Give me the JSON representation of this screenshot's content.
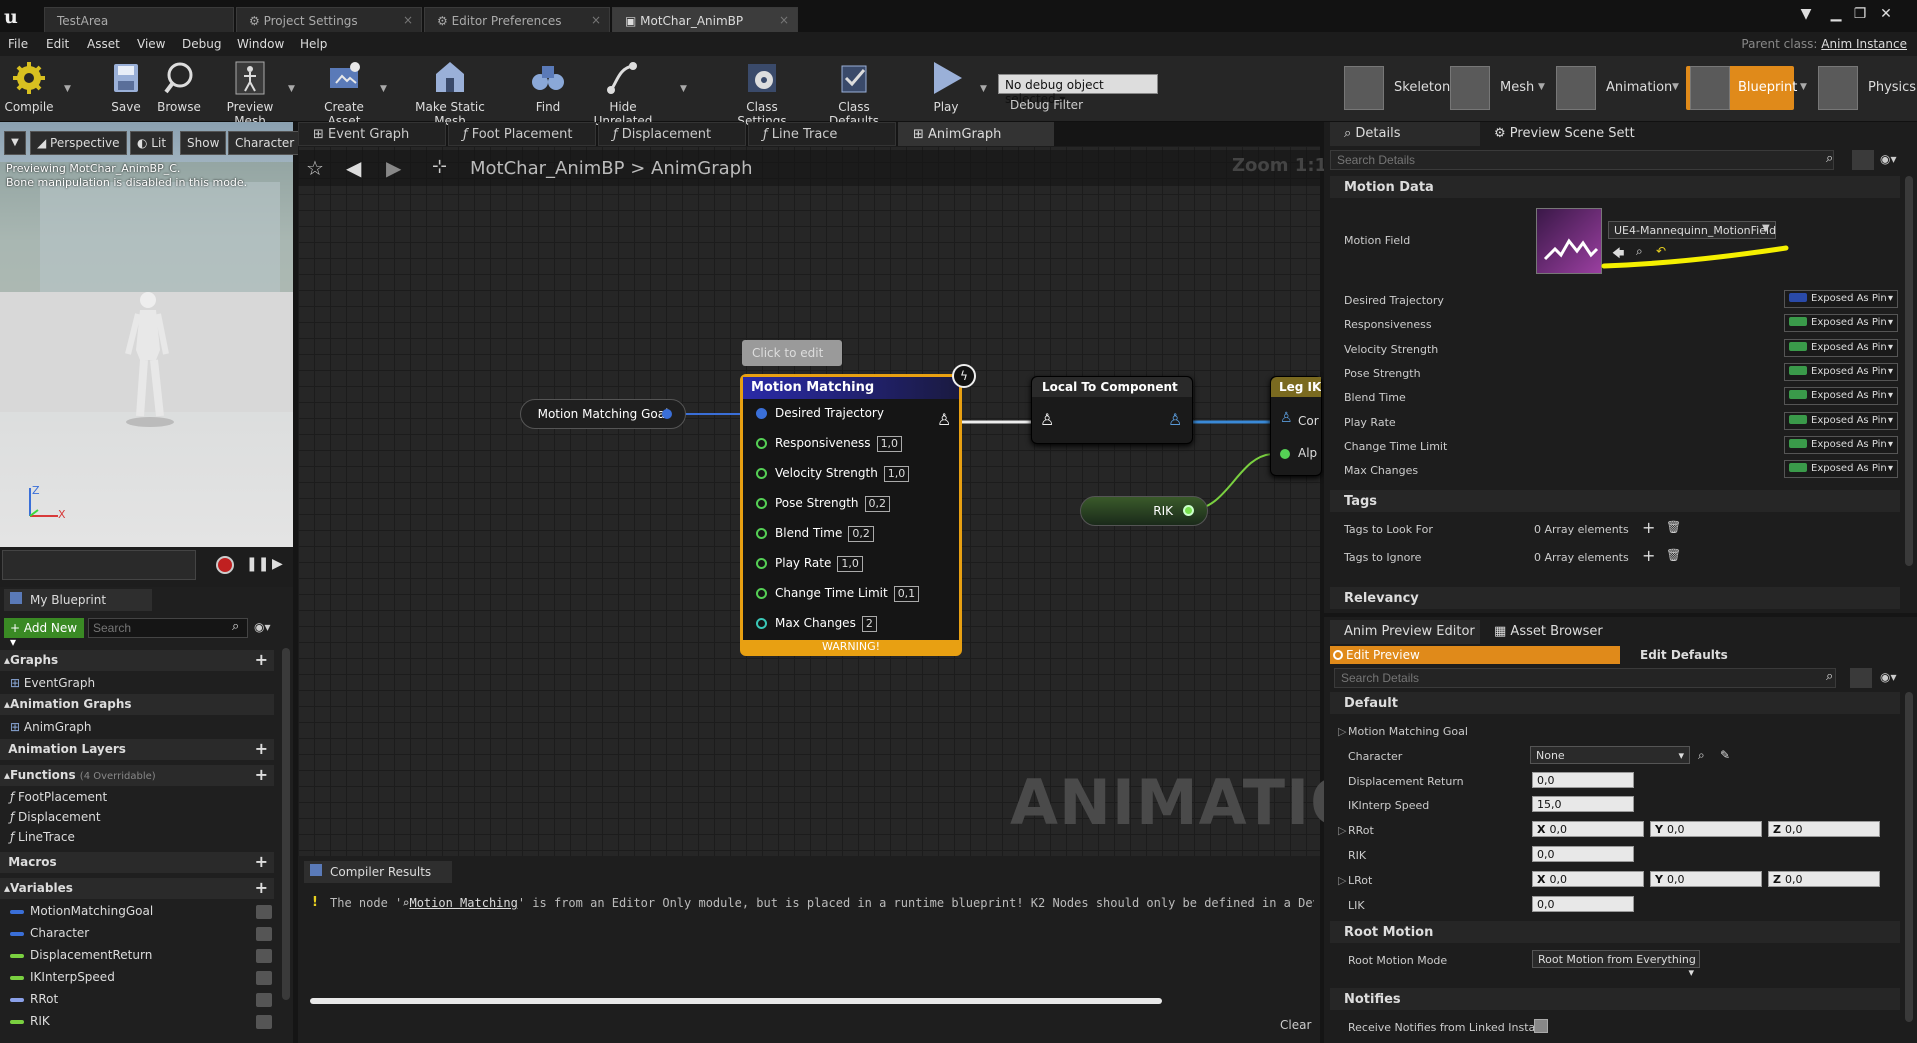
{
  "doc_tabs": [
    {
      "label": "TestArea"
    },
    {
      "label": "Project Settings"
    },
    {
      "label": "Editor Preferences"
    },
    {
      "label": "MotChar_AnimBP"
    }
  ],
  "menu": [
    "File",
    "Edit",
    "Asset",
    "View",
    "Debug",
    "Window",
    "Help"
  ],
  "parent_class": {
    "label": "Parent class:",
    "value": "Anim Instance"
  },
  "toolbar": {
    "buttons": [
      "Compile",
      "Save",
      "Browse",
      "Preview Mesh",
      "Create Asset",
      "Make Static Mesh",
      "Find",
      "Hide Unrelated",
      "Class Settings",
      "Class Defaults",
      "Play"
    ],
    "debug_object": "No debug object selected",
    "debug_filter": "Debug Filter"
  },
  "modes": [
    "Skeleton",
    "Mesh",
    "Animation",
    "Blueprint",
    "Physics"
  ],
  "viewport": {
    "buttons": [
      "Perspective",
      "Lit",
      "Show",
      "Character"
    ],
    "overlay_line1": "Previewing MotChar_AnimBP_C.",
    "overlay_line2": "Bone manipulation is disabled in this mode.",
    "axis_z": "Z",
    "axis_x": "X"
  },
  "my_blueprint": {
    "tab": "My Blueprint",
    "add_new": "+ Add New",
    "search_placeholder": "Search",
    "graphs_header": "Graphs",
    "graphs": [
      "EventGraph"
    ],
    "anim_graphs_header": "Animation Graphs",
    "anim_graphs": [
      "AnimGraph"
    ],
    "anim_layers_header": "Animation Layers",
    "functions_header": "Functions",
    "functions_note": "(4 Overridable)",
    "functions": [
      "FootPlacement",
      "Displacement",
      "LineTrace"
    ],
    "macros_header": "Macros",
    "variables_header": "Variables",
    "variables": [
      {
        "name": "MotionMatchingGoal",
        "color": "#3a6fd8"
      },
      {
        "name": "Character",
        "color": "#3a6fd8"
      },
      {
        "name": "DisplacementReturn",
        "color": "#7ad040"
      },
      {
        "name": "IKInterpSpeed",
        "color": "#7ad040"
      },
      {
        "name": "RRot",
        "color": "#8aa0e8"
      },
      {
        "name": "RIK",
        "color": "#7ad040"
      }
    ]
  },
  "graph_tabs": [
    "Event Graph",
    "Foot Placement",
    "Displacement",
    "Line Trace",
    "AnimGraph"
  ],
  "breadcrumb": {
    "bp": "MotChar_AnimBP",
    "sep": ">",
    "graph": "AnimGraph"
  },
  "zoom": "Zoom 1:1",
  "watermark": "ANIMATION",
  "nodes": {
    "goal": "Motion Matching Goal",
    "comment": "Click to edit",
    "mm_title": "Motion Matching",
    "mm_pins": [
      {
        "label": "Desired Trajectory",
        "value": ""
      },
      {
        "label": "Responsiveness",
        "value": "1,0"
      },
      {
        "label": "Velocity Strength",
        "value": "1,0"
      },
      {
        "label": "Pose Strength",
        "value": "0,2"
      },
      {
        "label": "Blend Time",
        "value": "0,2"
      },
      {
        "label": "Play Rate",
        "value": "1,0"
      },
      {
        "label": "Change Time Limit",
        "value": "0,1"
      },
      {
        "label": "Max Changes",
        "value": "2"
      }
    ],
    "mm_warning": "WARNING!",
    "ltc_title": "Local To Component",
    "legik_title": "Leg IK",
    "legik_pin1": "Cor",
    "legik_pin2": "Alp",
    "rik": "RIK"
  },
  "compiler": {
    "tab": "Compiler Results",
    "msg_prefix": "The node '",
    "msg_link": "Motion Matching",
    "msg_rest": "' is from an Editor Only module, but is placed in a runtime blueprint! K2 Nodes should only be defined in a Develop",
    "clear": "Clear"
  },
  "details": {
    "tab1": "Details",
    "tab2": "Preview Scene Sett",
    "search_placeholder": "Search Details",
    "motion_data": "Motion Data",
    "motion_field_label": "Motion Field",
    "motion_field_value": "UE4-Mannequinn_MotionField",
    "exposed_rows": [
      "Desired Trajectory",
      "Responsiveness",
      "Velocity Strength",
      "Pose Strength",
      "Blend Time",
      "Play Rate",
      "Change Time Limit",
      "Max Changes"
    ],
    "exposed_label": "Exposed As Pin",
    "tags": "Tags",
    "tags_look": "Tags to Look For",
    "tags_ignore": "Tags to Ignore",
    "array_elements": "0 Array elements",
    "relevancy": "Relevancy"
  },
  "preview": {
    "tab1": "Anim Preview Editor",
    "tab2": "Asset Browser",
    "edit_preview": "Edit Preview",
    "edit_defaults": "Edit Defaults",
    "search_placeholder": "Search Details",
    "default_header": "Default",
    "mm_goal": "Motion Matching Goal",
    "character_label": "Character",
    "character_value": "None",
    "disp_return_label": "Displacement Return",
    "disp_return_value": "0,0",
    "ikinterp_label": "IKInterp Speed",
    "ikinterp_value": "15,0",
    "rrot_label": "RRot",
    "rik_label": "RIK",
    "rik_value": "0,0",
    "lrot_label": "LRot",
    "lik_label": "LIK",
    "lik_value": "0,0",
    "vec_x": "X",
    "vec_y": "Y",
    "vec_z": "Z",
    "vec_val": "0,0",
    "root_motion_header": "Root Motion",
    "root_motion_mode_label": "Root Motion Mode",
    "root_motion_mode_value": "Root Motion from Everything",
    "notifies_header": "Notifies",
    "notifies_label": "Receive Notifies from Linked Instan"
  },
  "colors": {
    "accent_orange": "#e8a012",
    "pin_green": "#55d055",
    "annotation_yellow": "#f5f000"
  }
}
